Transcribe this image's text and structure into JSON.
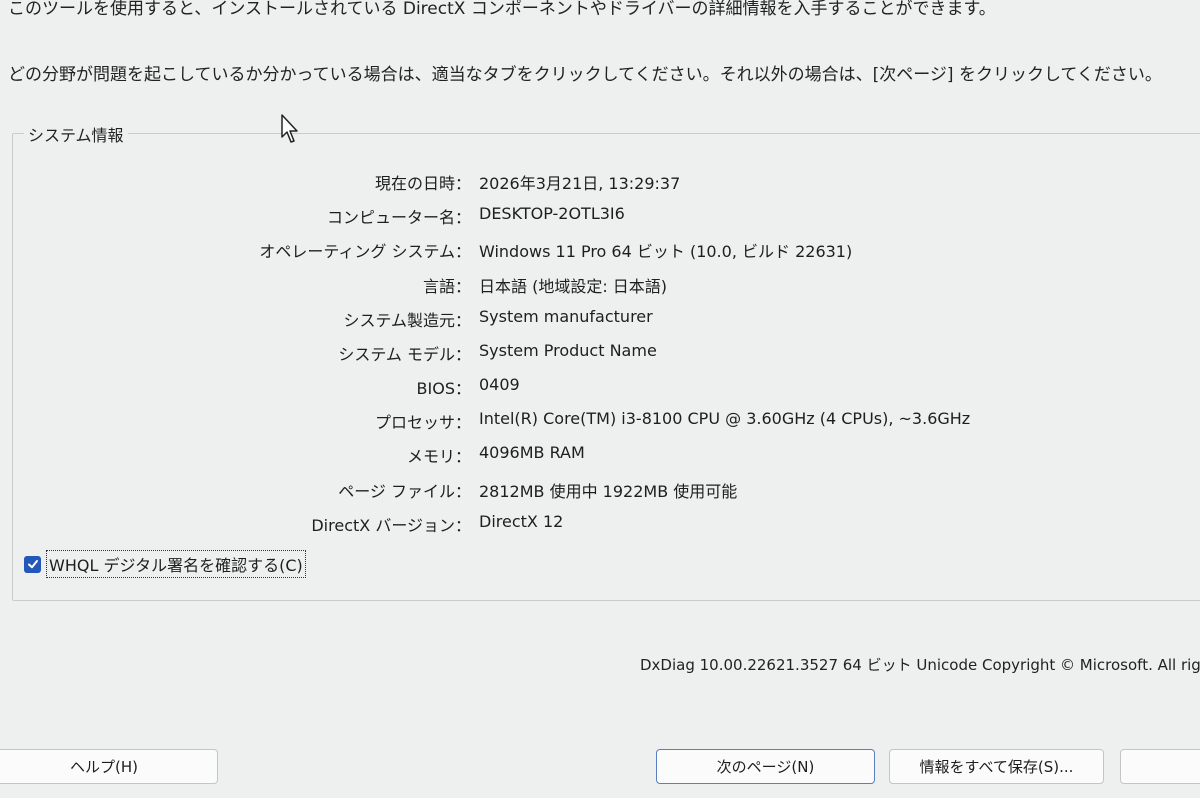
{
  "intro": {
    "line1": "このツールを使用すると、インストールされている DirectX コンポーネントやドライバーの詳細情報を入手することができます。",
    "line2": "どの分野が問題を起こしているか分かっている場合は、適当なタブをクリックしてください。それ以外の場合は、[次ページ] をクリックしてください。"
  },
  "system_info": {
    "title": "システム情報",
    "rows": [
      {
        "label": "現在の日時：",
        "value": "2026年3月21日, 13:29:37"
      },
      {
        "label": "コンピューター名：",
        "value": "DESKTOP-2OTL3I6"
      },
      {
        "label": "オペレーティング システム：",
        "value": "Windows 11 Pro 64 ビット (10.0, ビルド 22631)"
      },
      {
        "label": "言語：",
        "value": "日本語 (地域設定: 日本語)"
      },
      {
        "label": "システム製造元：",
        "value": "System manufacturer"
      },
      {
        "label": "システム モデル：",
        "value": "System Product Name"
      },
      {
        "label": "BIOS：",
        "value": "0409"
      },
      {
        "label": "プロセッサ：",
        "value": "Intel(R) Core(TM) i3-8100 CPU @ 3.60GHz (4 CPUs), ~3.6GHz"
      },
      {
        "label": "メモリ：",
        "value": "4096MB RAM"
      },
      {
        "label": "ページ ファイル：",
        "value": "2812MB 使用中 1922MB 使用可能"
      },
      {
        "label": "DirectX バージョン：",
        "value": "DirectX 12"
      }
    ]
  },
  "whql": {
    "label": "WHQL デジタル署名を確認する(C)",
    "checked": true
  },
  "footer": {
    "version_text": "DxDiag 10.00.22621.3527 64 ビット Unicode  Copyright © Microsoft. All rig"
  },
  "buttons": {
    "help": "ヘルプ(H)",
    "next": "次のページ(N)",
    "save_all": "情報をすべて保存(S)..."
  },
  "colors": {
    "background": "#eef0ef",
    "checkbox": "#2458b8",
    "primary_border": "#5a7fc0"
  }
}
